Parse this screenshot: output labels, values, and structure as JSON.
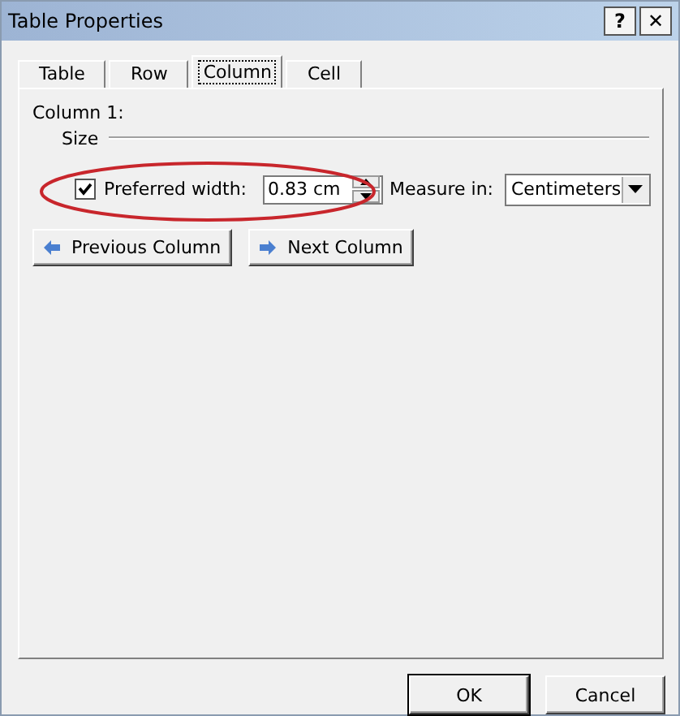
{
  "window": {
    "title": "Table Properties",
    "title_buttons": [
      "?",
      "✕"
    ]
  },
  "tabs": [
    {
      "label": "Table",
      "selected": false
    },
    {
      "label": "Row",
      "selected": false
    },
    {
      "label": "Column",
      "selected": true
    },
    {
      "label": "Cell",
      "selected": false
    }
  ],
  "column_label": "Column 1:",
  "size": {
    "legend": "Size",
    "preferred_width": {
      "label": "Preferred width:",
      "checked": true,
      "value": "0.83 cm"
    },
    "measure_in": {
      "label": "Measure in:",
      "value": "Centimeters"
    }
  },
  "nav_buttons": [
    {
      "label": "Previous Column",
      "kind": "previous"
    },
    {
      "label": "Next Column",
      "kind": "next"
    }
  ],
  "buttons": [
    "OK",
    "Cancel"
  ]
}
